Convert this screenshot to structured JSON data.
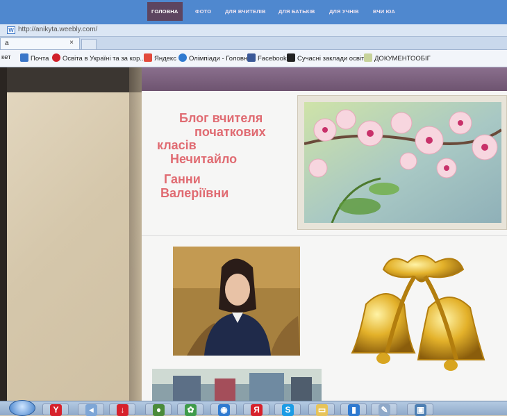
{
  "browser": {
    "url": "http://anikyta.weebly.com/",
    "tab_title": "a",
    "tab_close": "×",
    "favorites": [
      {
        "label": "кет",
        "icon": "none"
      },
      {
        "label": "Почта",
        "icon": "mail-icon",
        "color": "#3a76c8"
      },
      {
        "label": "Освіта в Україні та за кор...",
        "icon": "opera-icon",
        "color": "#d0202a"
      },
      {
        "label": "Яндекс",
        "icon": "yandex-icon",
        "color": "#e24a3c"
      },
      {
        "label": "Олімпіади - Головна",
        "icon": "people-icon",
        "color": "#2f7ad0"
      },
      {
        "label": "Facebook",
        "icon": "facebook-icon",
        "color": "#3b5998"
      },
      {
        "label": "Сучасні заклади освіти",
        "icon": "com-icon",
        "color": "#222222"
      },
      {
        "label": "ДОКУМЕНТООБІГ",
        "icon": "doc-icon",
        "color": "#9ab05a"
      }
    ]
  },
  "nav": {
    "items": [
      "ГОЛОВНА",
      "ФОТО",
      "ДЛЯ ВЧИТЕЛІВ",
      "ДЛЯ БАТЬКІВ",
      "ДЛЯ УЧНІВ",
      "ВЧИ ЮА"
    ],
    "active": "ГОЛОВНА"
  },
  "hero": {
    "title_lines": [
      "Блог вчителя",
      "початкових",
      "класів",
      "Нечитайло",
      "Ганни",
      "Валеріївни"
    ],
    "title_color": "#e06b72"
  },
  "taskbar": {
    "apps": [
      "start-icon",
      "yandex-browser-icon",
      "media-player-icon",
      "download-icon",
      "game-icon",
      "paint-icon",
      "chrome-icon",
      "yandex-icon",
      "skype-icon",
      "folder-icon",
      "app-icon",
      "paint-brush-icon",
      "picture-icon"
    ]
  }
}
